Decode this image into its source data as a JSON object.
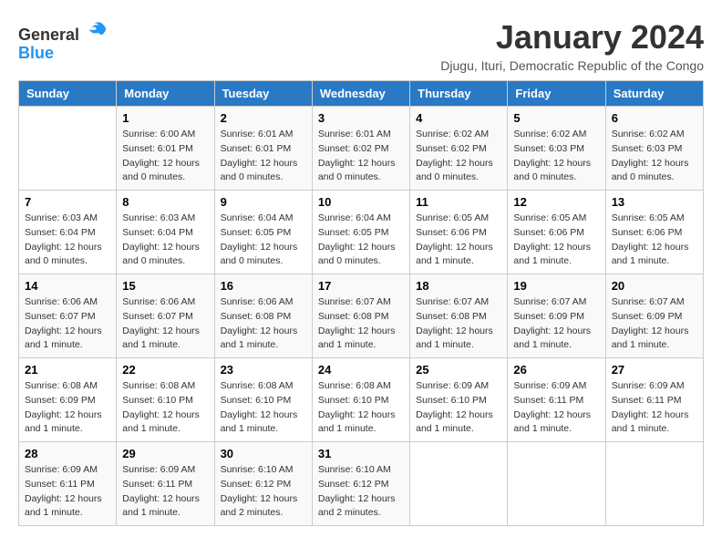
{
  "logo": {
    "general": "General",
    "blue": "Blue"
  },
  "title": "January 2024",
  "subtitle": "Djugu, Ituri, Democratic Republic of the Congo",
  "days_header": [
    "Sunday",
    "Monday",
    "Tuesday",
    "Wednesday",
    "Thursday",
    "Friday",
    "Saturday"
  ],
  "weeks": [
    [
      {
        "num": "",
        "info": ""
      },
      {
        "num": "1",
        "info": "Sunrise: 6:00 AM\nSunset: 6:01 PM\nDaylight: 12 hours\nand 0 minutes."
      },
      {
        "num": "2",
        "info": "Sunrise: 6:01 AM\nSunset: 6:01 PM\nDaylight: 12 hours\nand 0 minutes."
      },
      {
        "num": "3",
        "info": "Sunrise: 6:01 AM\nSunset: 6:02 PM\nDaylight: 12 hours\nand 0 minutes."
      },
      {
        "num": "4",
        "info": "Sunrise: 6:02 AM\nSunset: 6:02 PM\nDaylight: 12 hours\nand 0 minutes."
      },
      {
        "num": "5",
        "info": "Sunrise: 6:02 AM\nSunset: 6:03 PM\nDaylight: 12 hours\nand 0 minutes."
      },
      {
        "num": "6",
        "info": "Sunrise: 6:02 AM\nSunset: 6:03 PM\nDaylight: 12 hours\nand 0 minutes."
      }
    ],
    [
      {
        "num": "7",
        "info": "Sunrise: 6:03 AM\nSunset: 6:04 PM\nDaylight: 12 hours\nand 0 minutes."
      },
      {
        "num": "8",
        "info": "Sunrise: 6:03 AM\nSunset: 6:04 PM\nDaylight: 12 hours\nand 0 minutes."
      },
      {
        "num": "9",
        "info": "Sunrise: 6:04 AM\nSunset: 6:05 PM\nDaylight: 12 hours\nand 0 minutes."
      },
      {
        "num": "10",
        "info": "Sunrise: 6:04 AM\nSunset: 6:05 PM\nDaylight: 12 hours\nand 0 minutes."
      },
      {
        "num": "11",
        "info": "Sunrise: 6:05 AM\nSunset: 6:06 PM\nDaylight: 12 hours\nand 1 minute."
      },
      {
        "num": "12",
        "info": "Sunrise: 6:05 AM\nSunset: 6:06 PM\nDaylight: 12 hours\nand 1 minute."
      },
      {
        "num": "13",
        "info": "Sunrise: 6:05 AM\nSunset: 6:06 PM\nDaylight: 12 hours\nand 1 minute."
      }
    ],
    [
      {
        "num": "14",
        "info": "Sunrise: 6:06 AM\nSunset: 6:07 PM\nDaylight: 12 hours\nand 1 minute."
      },
      {
        "num": "15",
        "info": "Sunrise: 6:06 AM\nSunset: 6:07 PM\nDaylight: 12 hours\nand 1 minute."
      },
      {
        "num": "16",
        "info": "Sunrise: 6:06 AM\nSunset: 6:08 PM\nDaylight: 12 hours\nand 1 minute."
      },
      {
        "num": "17",
        "info": "Sunrise: 6:07 AM\nSunset: 6:08 PM\nDaylight: 12 hours\nand 1 minute."
      },
      {
        "num": "18",
        "info": "Sunrise: 6:07 AM\nSunset: 6:08 PM\nDaylight: 12 hours\nand 1 minute."
      },
      {
        "num": "19",
        "info": "Sunrise: 6:07 AM\nSunset: 6:09 PM\nDaylight: 12 hours\nand 1 minute."
      },
      {
        "num": "20",
        "info": "Sunrise: 6:07 AM\nSunset: 6:09 PM\nDaylight: 12 hours\nand 1 minute."
      }
    ],
    [
      {
        "num": "21",
        "info": "Sunrise: 6:08 AM\nSunset: 6:09 PM\nDaylight: 12 hours\nand 1 minute."
      },
      {
        "num": "22",
        "info": "Sunrise: 6:08 AM\nSunset: 6:10 PM\nDaylight: 12 hours\nand 1 minute."
      },
      {
        "num": "23",
        "info": "Sunrise: 6:08 AM\nSunset: 6:10 PM\nDaylight: 12 hours\nand 1 minute."
      },
      {
        "num": "24",
        "info": "Sunrise: 6:08 AM\nSunset: 6:10 PM\nDaylight: 12 hours\nand 1 minute."
      },
      {
        "num": "25",
        "info": "Sunrise: 6:09 AM\nSunset: 6:10 PM\nDaylight: 12 hours\nand 1 minute."
      },
      {
        "num": "26",
        "info": "Sunrise: 6:09 AM\nSunset: 6:11 PM\nDaylight: 12 hours\nand 1 minute."
      },
      {
        "num": "27",
        "info": "Sunrise: 6:09 AM\nSunset: 6:11 PM\nDaylight: 12 hours\nand 1 minute."
      }
    ],
    [
      {
        "num": "28",
        "info": "Sunrise: 6:09 AM\nSunset: 6:11 PM\nDaylight: 12 hours\nand 1 minute."
      },
      {
        "num": "29",
        "info": "Sunrise: 6:09 AM\nSunset: 6:11 PM\nDaylight: 12 hours\nand 1 minute."
      },
      {
        "num": "30",
        "info": "Sunrise: 6:10 AM\nSunset: 6:12 PM\nDaylight: 12 hours\nand 2 minutes."
      },
      {
        "num": "31",
        "info": "Sunrise: 6:10 AM\nSunset: 6:12 PM\nDaylight: 12 hours\nand 2 minutes."
      },
      {
        "num": "",
        "info": ""
      },
      {
        "num": "",
        "info": ""
      },
      {
        "num": "",
        "info": ""
      }
    ]
  ]
}
